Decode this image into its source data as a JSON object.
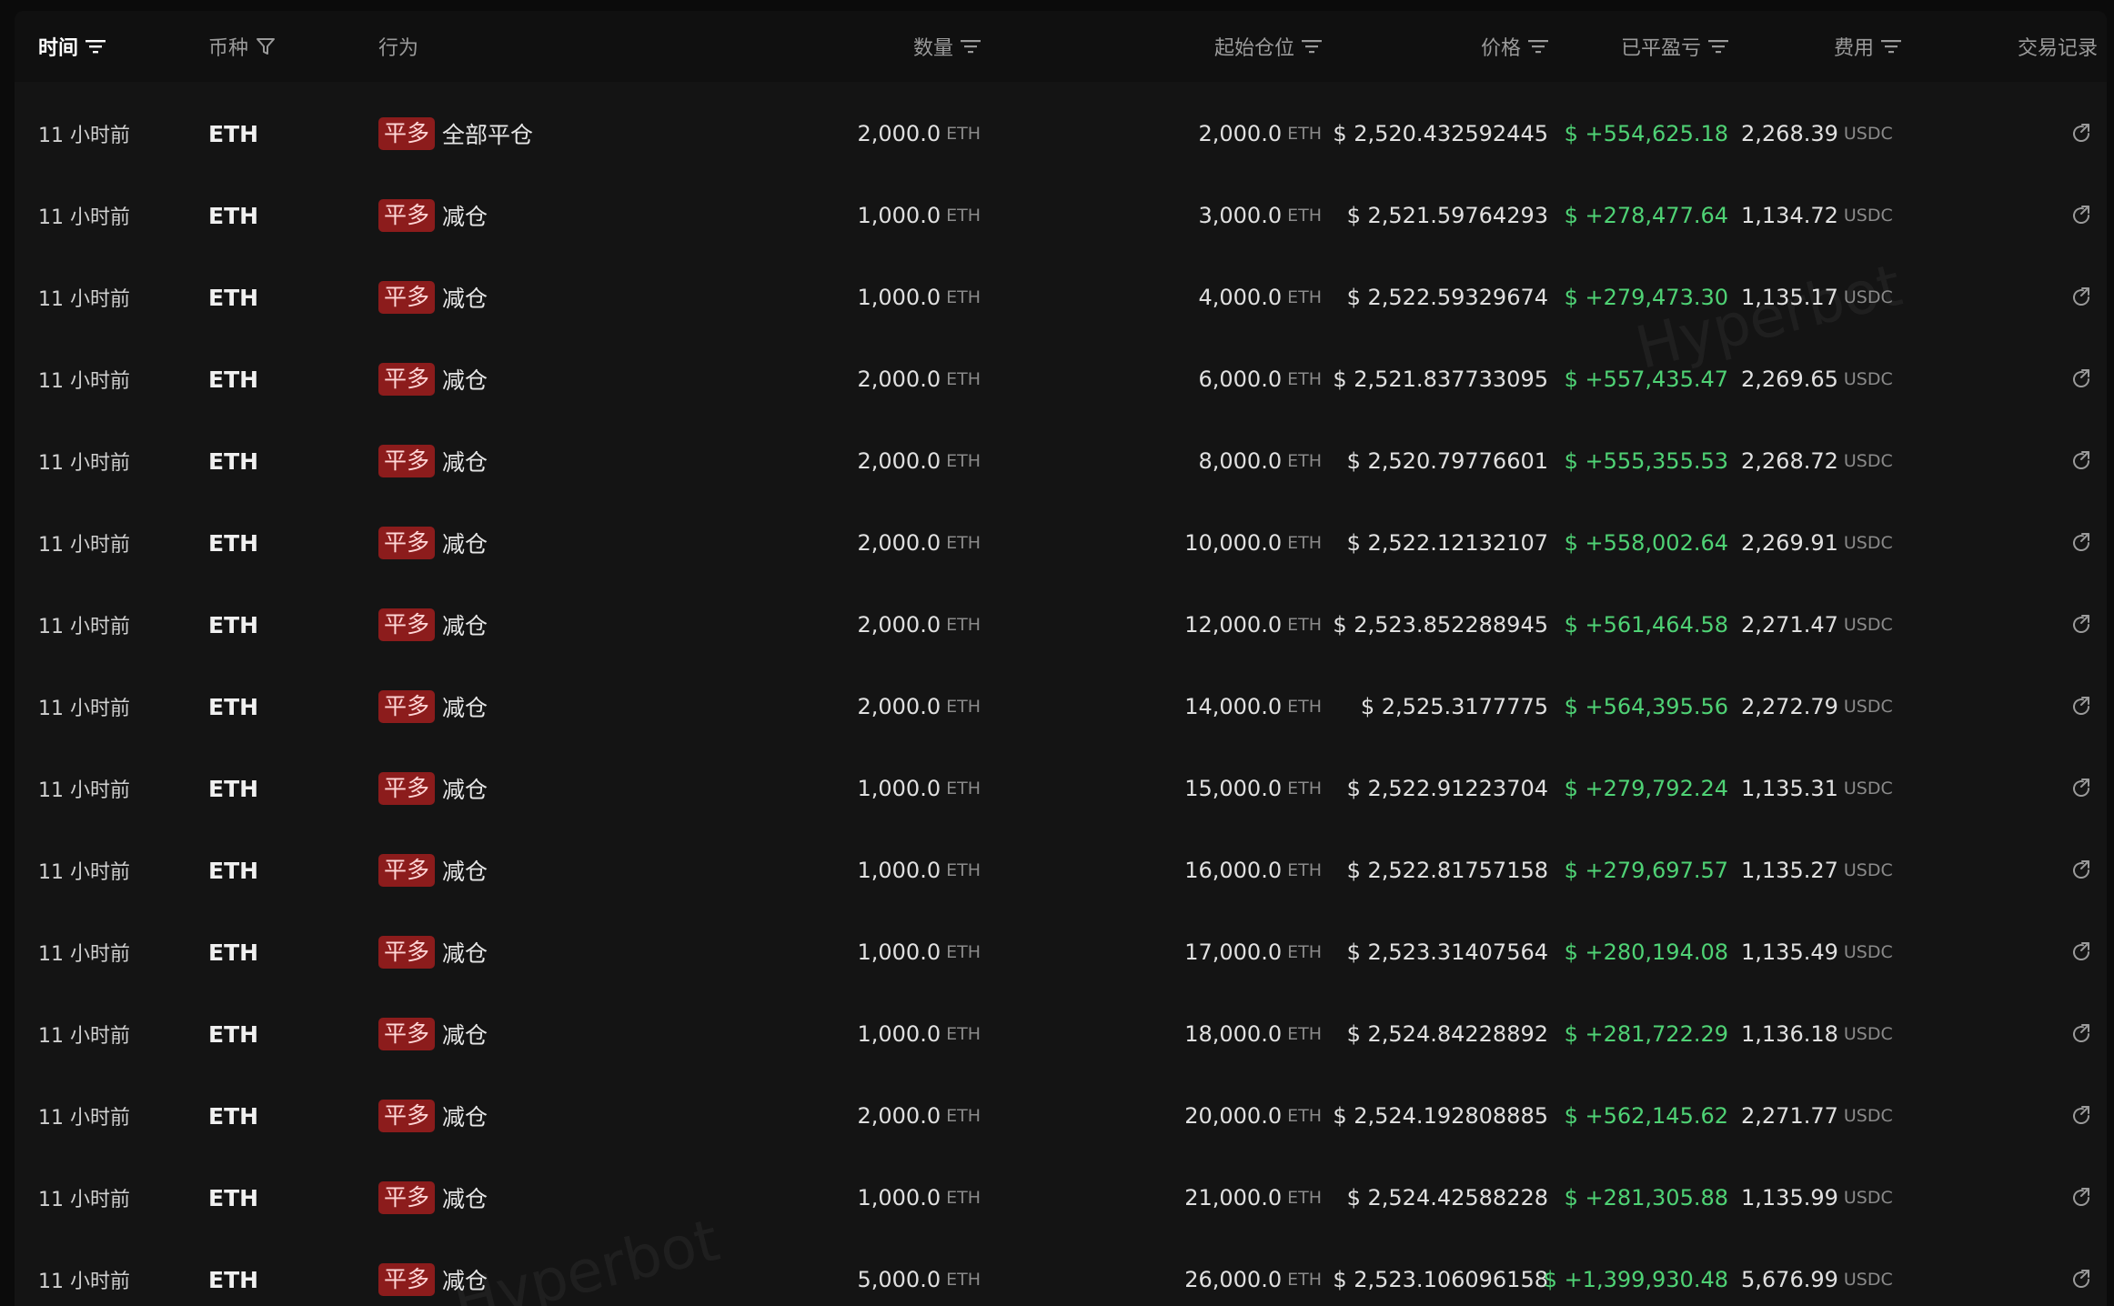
{
  "header": {
    "time": "时间",
    "coin": "币种",
    "action": "行为",
    "quantity": "数量",
    "start_position": "起始仓位",
    "price": "价格",
    "closed_pnl": "已平盈亏",
    "fee": "费用",
    "trade_record": "交易记录"
  },
  "watermark": "Hyperbot",
  "colors": {
    "background": "#0b0b0b",
    "panel": "#141414",
    "profit": "#4fd275",
    "close_long_badge": "#8c1c1c"
  },
  "rows": [
    {
      "time": "11 小时前",
      "coin": "ETH",
      "badge": "平多",
      "action": "全部平仓",
      "qty": "2,000.0",
      "qty_unit": "ETH",
      "start": "2,000.0",
      "start_unit": "ETH",
      "price": "$ 2,520.432592445",
      "pnl": "$ +554,625.18",
      "fee": "2,268.39",
      "fee_unit": "USDC"
    },
    {
      "time": "11 小时前",
      "coin": "ETH",
      "badge": "平多",
      "action": "减仓",
      "qty": "1,000.0",
      "qty_unit": "ETH",
      "start": "3,000.0",
      "start_unit": "ETH",
      "price": "$ 2,521.59764293",
      "pnl": "$ +278,477.64",
      "fee": "1,134.72",
      "fee_unit": "USDC"
    },
    {
      "time": "11 小时前",
      "coin": "ETH",
      "badge": "平多",
      "action": "减仓",
      "qty": "1,000.0",
      "qty_unit": "ETH",
      "start": "4,000.0",
      "start_unit": "ETH",
      "price": "$ 2,522.59329674",
      "pnl": "$ +279,473.30",
      "fee": "1,135.17",
      "fee_unit": "USDC"
    },
    {
      "time": "11 小时前",
      "coin": "ETH",
      "badge": "平多",
      "action": "减仓",
      "qty": "2,000.0",
      "qty_unit": "ETH",
      "start": "6,000.0",
      "start_unit": "ETH",
      "price": "$ 2,521.837733095",
      "pnl": "$ +557,435.47",
      "fee": "2,269.65",
      "fee_unit": "USDC"
    },
    {
      "time": "11 小时前",
      "coin": "ETH",
      "badge": "平多",
      "action": "减仓",
      "qty": "2,000.0",
      "qty_unit": "ETH",
      "start": "8,000.0",
      "start_unit": "ETH",
      "price": "$ 2,520.79776601",
      "pnl": "$ +555,355.53",
      "fee": "2,268.72",
      "fee_unit": "USDC"
    },
    {
      "time": "11 小时前",
      "coin": "ETH",
      "badge": "平多",
      "action": "减仓",
      "qty": "2,000.0",
      "qty_unit": "ETH",
      "start": "10,000.0",
      "start_unit": "ETH",
      "price": "$ 2,522.12132107",
      "pnl": "$ +558,002.64",
      "fee": "2,269.91",
      "fee_unit": "USDC"
    },
    {
      "time": "11 小时前",
      "coin": "ETH",
      "badge": "平多",
      "action": "减仓",
      "qty": "2,000.0",
      "qty_unit": "ETH",
      "start": "12,000.0",
      "start_unit": "ETH",
      "price": "$ 2,523.852288945",
      "pnl": "$ +561,464.58",
      "fee": "2,271.47",
      "fee_unit": "USDC"
    },
    {
      "time": "11 小时前",
      "coin": "ETH",
      "badge": "平多",
      "action": "减仓",
      "qty": "2,000.0",
      "qty_unit": "ETH",
      "start": "14,000.0",
      "start_unit": "ETH",
      "price": "$ 2,525.3177775",
      "pnl": "$ +564,395.56",
      "fee": "2,272.79",
      "fee_unit": "USDC"
    },
    {
      "time": "11 小时前",
      "coin": "ETH",
      "badge": "平多",
      "action": "减仓",
      "qty": "1,000.0",
      "qty_unit": "ETH",
      "start": "15,000.0",
      "start_unit": "ETH",
      "price": "$ 2,522.91223704",
      "pnl": "$ +279,792.24",
      "fee": "1,135.31",
      "fee_unit": "USDC"
    },
    {
      "time": "11 小时前",
      "coin": "ETH",
      "badge": "平多",
      "action": "减仓",
      "qty": "1,000.0",
      "qty_unit": "ETH",
      "start": "16,000.0",
      "start_unit": "ETH",
      "price": "$ 2,522.81757158",
      "pnl": "$ +279,697.57",
      "fee": "1,135.27",
      "fee_unit": "USDC"
    },
    {
      "time": "11 小时前",
      "coin": "ETH",
      "badge": "平多",
      "action": "减仓",
      "qty": "1,000.0",
      "qty_unit": "ETH",
      "start": "17,000.0",
      "start_unit": "ETH",
      "price": "$ 2,523.31407564",
      "pnl": "$ +280,194.08",
      "fee": "1,135.49",
      "fee_unit": "USDC"
    },
    {
      "time": "11 小时前",
      "coin": "ETH",
      "badge": "平多",
      "action": "减仓",
      "qty": "1,000.0",
      "qty_unit": "ETH",
      "start": "18,000.0",
      "start_unit": "ETH",
      "price": "$ 2,524.84228892",
      "pnl": "$ +281,722.29",
      "fee": "1,136.18",
      "fee_unit": "USDC"
    },
    {
      "time": "11 小时前",
      "coin": "ETH",
      "badge": "平多",
      "action": "减仓",
      "qty": "2,000.0",
      "qty_unit": "ETH",
      "start": "20,000.0",
      "start_unit": "ETH",
      "price": "$ 2,524.192808885",
      "pnl": "$ +562,145.62",
      "fee": "2,271.77",
      "fee_unit": "USDC"
    },
    {
      "time": "11 小时前",
      "coin": "ETH",
      "badge": "平多",
      "action": "减仓",
      "qty": "1,000.0",
      "qty_unit": "ETH",
      "start": "21,000.0",
      "start_unit": "ETH",
      "price": "$ 2,524.42588228",
      "pnl": "$ +281,305.88",
      "fee": "1,135.99",
      "fee_unit": "USDC"
    },
    {
      "time": "11 小时前",
      "coin": "ETH",
      "badge": "平多",
      "action": "减仓",
      "qty": "5,000.0",
      "qty_unit": "ETH",
      "start": "26,000.0",
      "start_unit": "ETH",
      "price": "$ 2,523.106096158",
      "pnl": "$ +1,399,930.48",
      "fee": "5,676.99",
      "fee_unit": "USDC"
    }
  ]
}
